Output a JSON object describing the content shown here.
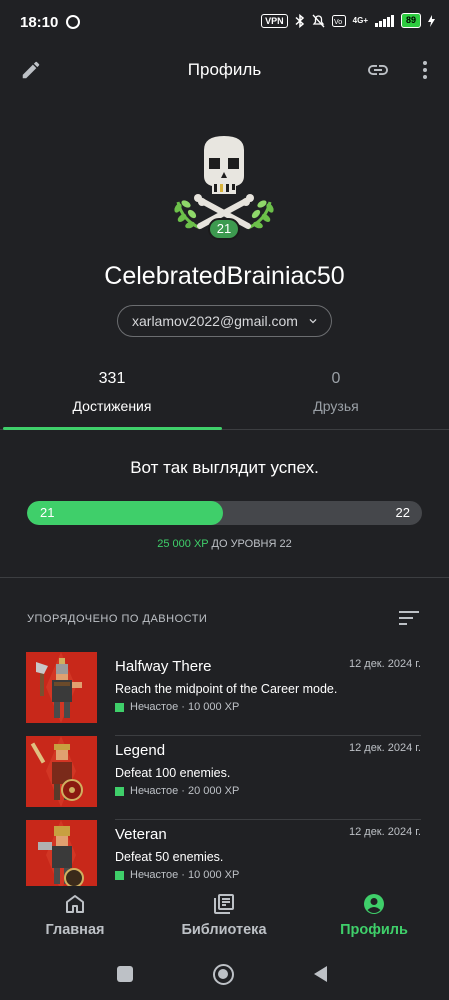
{
  "status_bar": {
    "time": "18:10",
    "vpn": "VPN",
    "network": "4G+",
    "battery": "89",
    "icons": [
      "record-icon",
      "bluetooth-icon",
      "mute-icon",
      "volte-icon",
      "signal-icon",
      "battery-icon",
      "charging-icon"
    ]
  },
  "header": {
    "title": "Профиль",
    "left_icon": "edit-icon",
    "right_icons": [
      "link-icon",
      "more-vert-icon"
    ]
  },
  "profile": {
    "level": "21",
    "username": "CelebratedBrainiac50",
    "email": "xarlamov2022@gmail.com"
  },
  "tabs": [
    {
      "count": "331",
      "label": "Достижения",
      "active": true
    },
    {
      "count": "0",
      "label": "Друзья",
      "active": false
    }
  ],
  "progress": {
    "headline": "Вот так выглядит успех.",
    "current_level": "21",
    "next_level": "22",
    "fill_fraction": 0.495,
    "xp_amount": "25 000 XP",
    "xp_suffix": " ДО УРОВНЯ 22"
  },
  "list": {
    "sort_label": "УПОРЯДОЧЕНО ПО ДАВНОСТИ",
    "items": [
      {
        "title": "Halfway There",
        "date": "12 дек. 2024 г.",
        "description": "Reach the midpoint of the Career mode.",
        "meta": "Нечастое · 10 000 XP"
      },
      {
        "title": "Legend",
        "date": "12 дек. 2024 г.",
        "description": "Defeat 100 enemies.",
        "meta": "Нечастое · 20 000 XP"
      },
      {
        "title": "Veteran",
        "date": "12 дек. 2024 г.",
        "description": "Defeat 50 enemies.",
        "meta": "Нечастое · 10 000 XP"
      }
    ]
  },
  "bottom_nav": [
    {
      "label": "Главная",
      "icon": "home-icon",
      "active": false
    },
    {
      "label": "Библиотека",
      "icon": "library-icon",
      "active": false
    },
    {
      "label": "Профиль",
      "icon": "account-icon",
      "active": true
    }
  ],
  "colors": {
    "background": "#202124",
    "accent": "#3fcf6a",
    "achievement_bg": "#c8281a"
  }
}
